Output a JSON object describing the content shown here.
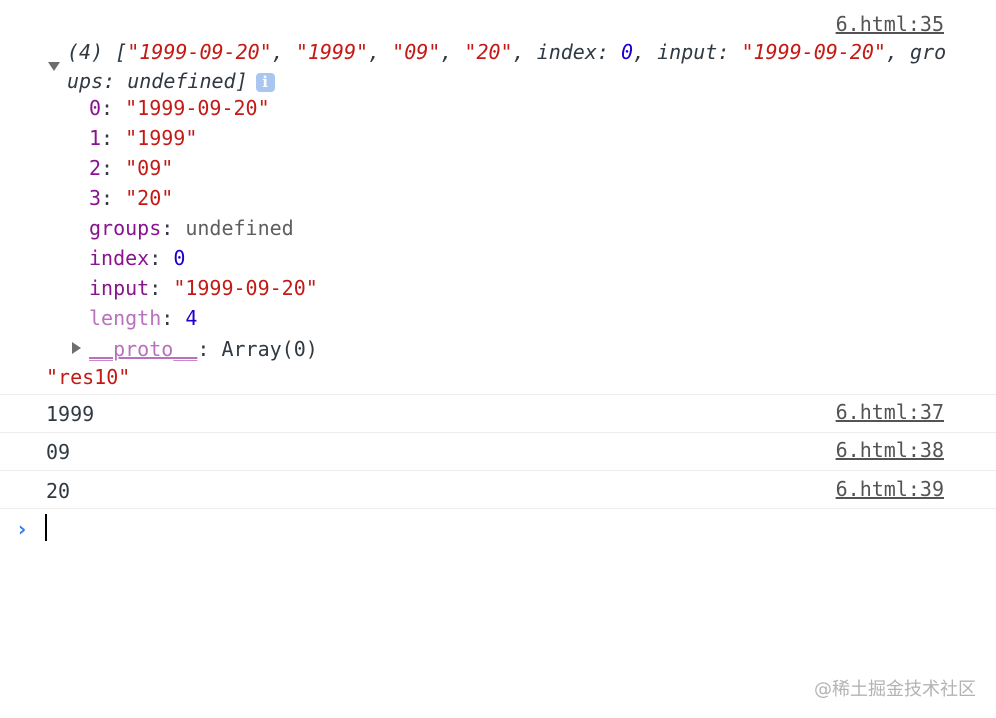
{
  "entries": {
    "first_source": "6.html:35",
    "array_summary": {
      "count": "(4)",
      "open": "[",
      "v0": "\"1999-09-20\"",
      "v1": "\"1999\"",
      "v2": "\"09\"",
      "v3": "\"20\"",
      "sep": ", ",
      "index_key": "index",
      "index_val": "0",
      "input_key": "input",
      "input_val": "\"1999-09-20\"",
      "groups_key": "groups",
      "groups_val": "undefined",
      "close": "]",
      "colon": ": "
    },
    "expanded": [
      {
        "key": "0",
        "value": "\"1999-09-20\"",
        "type": "string"
      },
      {
        "key": "1",
        "value": "\"1999\"",
        "type": "string"
      },
      {
        "key": "2",
        "value": "\"09\"",
        "type": "string"
      },
      {
        "key": "3",
        "value": "\"20\"",
        "type": "string"
      },
      {
        "key": "groups",
        "value": "undefined",
        "type": "undefined"
      },
      {
        "key": "index",
        "value": "0",
        "type": "number"
      },
      {
        "key": "input",
        "value": "\"1999-09-20\"",
        "type": "string"
      },
      {
        "key": "length",
        "value": "4",
        "type": "number"
      }
    ],
    "proto_key": "__proto__",
    "proto_value": "Array(0)",
    "second_label": "\"res10\"",
    "logs": [
      {
        "value": "1999",
        "source": "6.html:37"
      },
      {
        "value": "09",
        "source": "6.html:38"
      },
      {
        "value": "20",
        "source": "6.html:39"
      }
    ]
  },
  "info_badge": "i",
  "watermark": "@稀土掘金技术社区",
  "colors": {
    "string": "#c41a16",
    "number": "#1c00cf",
    "key": "#881391",
    "prompt": "#367cf1"
  }
}
